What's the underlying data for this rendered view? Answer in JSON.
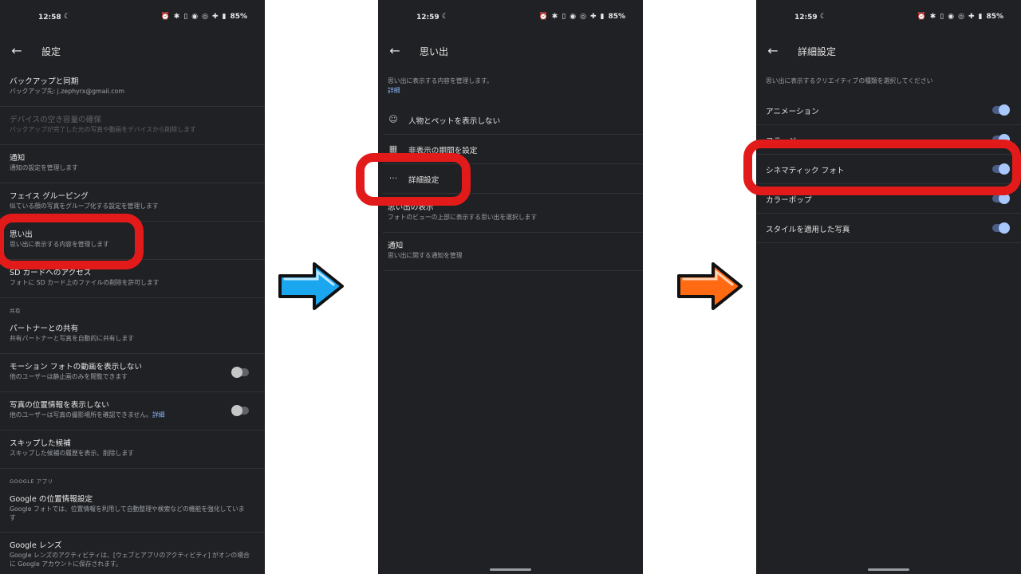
{
  "colors": {
    "highlight": "#e31a1a",
    "arrow1": "#1ba6f0",
    "arrow2": "#ff6a13",
    "accent": "#8ab4f8"
  },
  "screen1": {
    "status": {
      "time": "12:58",
      "battery": "85%"
    },
    "title": "設定",
    "items": [
      {
        "title": "バックアップと同期",
        "sub": "バックアップ先: j.zephyrx@gmail.com"
      },
      {
        "title": "デバイスの空き容量の確保",
        "sub": "バックアップが完了した元の写真や動画をデバイスから削除します"
      },
      {
        "title": "通知",
        "sub": "通知の設定を管理します"
      },
      {
        "title": "フェイス グルーピング",
        "sub": "似ている顔の写真をグループ化する設定を管理します"
      },
      {
        "title": "思い出",
        "sub": "思い出に表示する内容を管理します"
      },
      {
        "title": "SD カードへのアクセス",
        "sub": "フォトに SD カード上のファイルの削除を許可します"
      }
    ],
    "section_shared": "共有",
    "shared_items": [
      {
        "title": "パートナーとの共有",
        "sub": "共有パートナーと写真を自動的に共有します"
      },
      {
        "title": "モーション フォトの動画を表示しない",
        "sub": "他のユーザーは静止画のみを閲覧できます"
      },
      {
        "title": "写真の位置情報を表示しない",
        "sub": "他のユーザーは写真の撮影場所を確認できません。",
        "link": "詳細"
      },
      {
        "title": "スキップした候補",
        "sub": "スキップした候補の履歴を表示、削除します"
      }
    ],
    "section_google": "GOOGLE アプリ",
    "google_items": [
      {
        "title": "Google の位置情報設定",
        "sub": "Google フォトでは、位置情報を利用して自動整理や検索などの機能を強化しています"
      },
      {
        "title": "Google レンズ",
        "sub": "Google レンズのアクティビティは、[ウェブとアプリのアクティビティ] がオンの場合に Google アカウントに保存されます。"
      }
    ]
  },
  "screen2": {
    "status": {
      "time": "12:59",
      "battery": "85%"
    },
    "title": "思い出",
    "desc": "思い出に表示する内容を管理します。",
    "desc_link": "詳細",
    "rows": [
      {
        "icon": "face-icon",
        "label": "人物とペットを表示しない"
      },
      {
        "icon": "calendar-icon",
        "label": "非表示の期間を設定"
      },
      {
        "icon": "more-dots-icon",
        "label": "詳細設定"
      }
    ],
    "items": [
      {
        "title": "思い出の表示",
        "sub": "フォトのビューの上部に表示する思い出を選択します"
      },
      {
        "title": "通知",
        "sub": "思い出に関する通知を管理"
      }
    ]
  },
  "screen3": {
    "status": {
      "time": "12:59",
      "battery": "85%"
    },
    "title": "詳細設定",
    "desc": "思い出に表示するクリエイティブの種類を選択してください",
    "rows": [
      {
        "label": "アニメーション",
        "on": true
      },
      {
        "label": "コラージュ",
        "on": true
      },
      {
        "label": "シネマティック フォト",
        "on": true
      },
      {
        "label": "カラーポップ",
        "on": true
      },
      {
        "label": "スタイルを適用した写真",
        "on": true
      }
    ]
  }
}
